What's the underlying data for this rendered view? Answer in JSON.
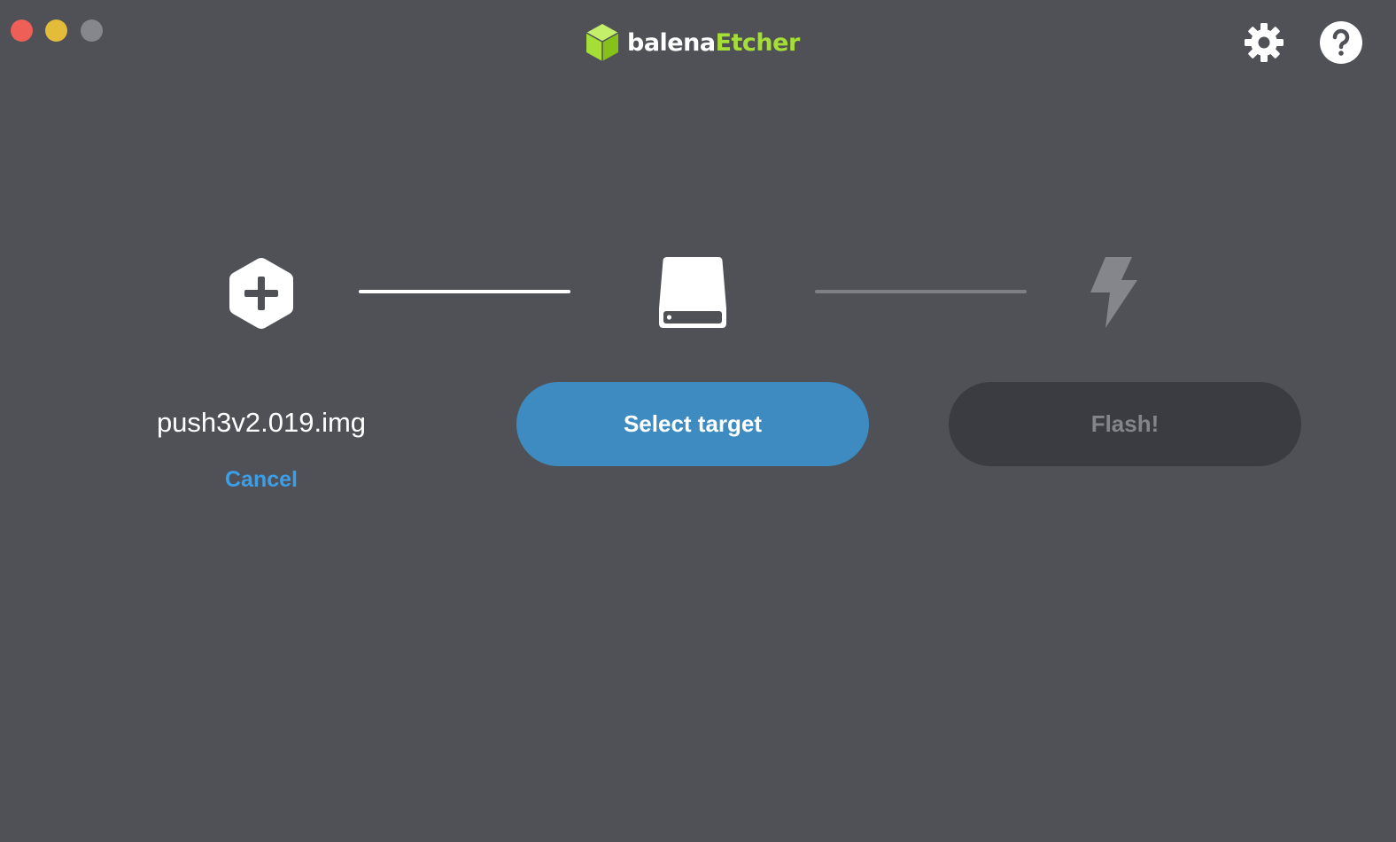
{
  "window": {
    "controls": {
      "close_color": "#ed5f57",
      "minimize_color": "#e3bc39",
      "maximize_color": "#85878d"
    }
  },
  "header": {
    "logo_part1": "balena",
    "logo_part2": "Etcher",
    "logo_green": "#a5de37",
    "icons": [
      "gear-icon",
      "help-icon"
    ]
  },
  "steps": {
    "source": {
      "icon": "hexagon-plus-icon",
      "file_name": "push3v2.019.img",
      "cancel_label": "Cancel"
    },
    "target": {
      "icon": "drive-icon",
      "button_label": "Select target"
    },
    "flash": {
      "icon": "lightning-icon",
      "button_label": "Flash!"
    }
  },
  "colors": {
    "background": "#4f5157",
    "accent_blue": "#3d8bc1",
    "link_blue": "#3d9ee8",
    "disabled_button": "#3a3c41",
    "disabled_text": "#83858b",
    "connector_active": "#ffffff",
    "connector_inactive": "#7e8086"
  }
}
